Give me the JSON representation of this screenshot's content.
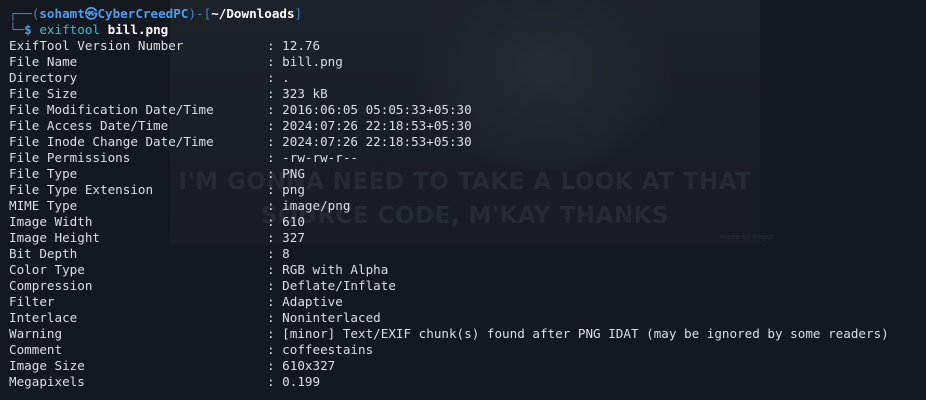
{
  "background": {
    "caption_line1": "I'M GONNA NEED TO TAKE A LOOK AT THAT",
    "caption_line2": "SOURCE CODE, M'KAY THANKS",
    "watermark": "made on imgur"
  },
  "prompt": {
    "box_top": "┌──(",
    "user": "sohamt",
    "at_symbol": "㉿",
    "host": "CyberCreedPC",
    "mid": ")-[",
    "cwd": "~/Downloads",
    "close": "]",
    "box_bottom": "└─",
    "dollar": "$ ",
    "command": "exiftool",
    "argument": "bill.png"
  },
  "separator": ": ",
  "exif": [
    {
      "tag": "ExifTool Version Number",
      "value": "12.76"
    },
    {
      "tag": "File Name",
      "value": "bill.png"
    },
    {
      "tag": "Directory",
      "value": "."
    },
    {
      "tag": "File Size",
      "value": "323 kB"
    },
    {
      "tag": "File Modification Date/Time",
      "value": "2016:06:05 05:05:33+05:30"
    },
    {
      "tag": "File Access Date/Time",
      "value": "2024:07:26 22:18:53+05:30"
    },
    {
      "tag": "File Inode Change Date/Time",
      "value": "2024:07:26 22:18:53+05:30"
    },
    {
      "tag": "File Permissions",
      "value": "-rw-rw-r--"
    },
    {
      "tag": "File Type",
      "value": "PNG"
    },
    {
      "tag": "File Type Extension",
      "value": "png"
    },
    {
      "tag": "MIME Type",
      "value": "image/png"
    },
    {
      "tag": "Image Width",
      "value": "610"
    },
    {
      "tag": "Image Height",
      "value": "327"
    },
    {
      "tag": "Bit Depth",
      "value": "8"
    },
    {
      "tag": "Color Type",
      "value": "RGB with Alpha"
    },
    {
      "tag": "Compression",
      "value": "Deflate/Inflate"
    },
    {
      "tag": "Filter",
      "value": "Adaptive"
    },
    {
      "tag": "Interlace",
      "value": "Noninterlaced"
    },
    {
      "tag": "Warning",
      "value": "[minor] Text/EXIF chunk(s) found after PNG IDAT (may be ignored by some readers)"
    },
    {
      "tag": "Comment",
      "value": "coffeestains"
    },
    {
      "tag": "Image Size",
      "value": "610x327"
    },
    {
      "tag": "Megapixels",
      "value": "0.199"
    }
  ]
}
